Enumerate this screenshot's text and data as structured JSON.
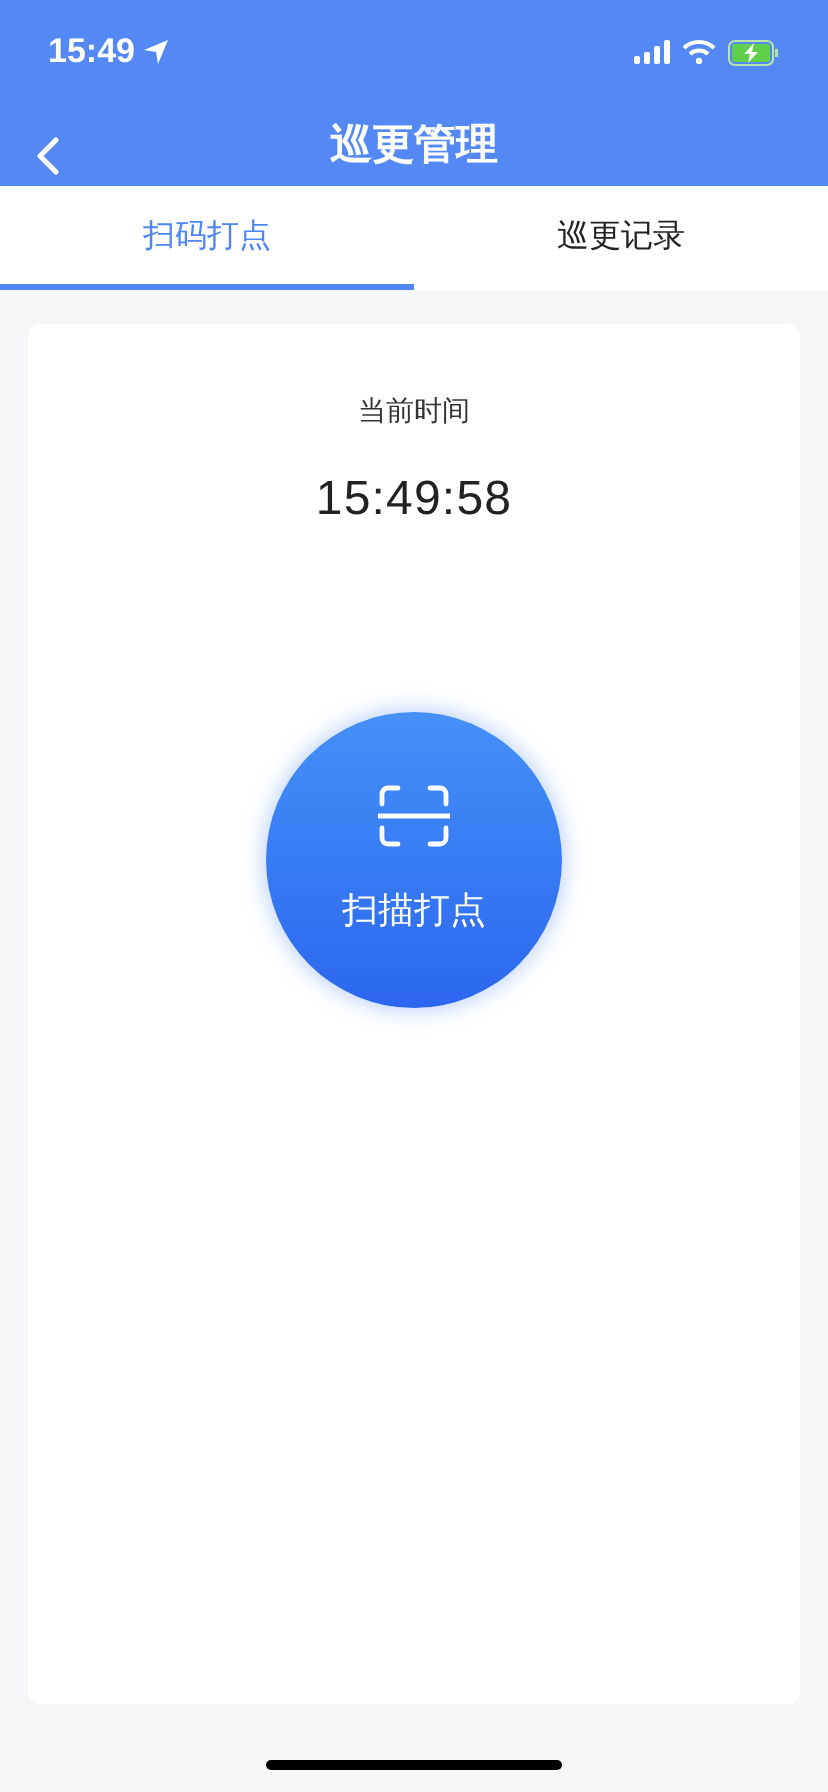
{
  "status_bar": {
    "time": "15:49"
  },
  "nav_bar": {
    "title": "巡更管理"
  },
  "tabs": [
    {
      "label": "扫码打点",
      "selected": true
    },
    {
      "label": "巡更记录",
      "selected": false
    }
  ],
  "clock": {
    "label": "当前时间",
    "time": "15:49:58"
  },
  "scan_button": {
    "label": "扫描打点"
  }
}
